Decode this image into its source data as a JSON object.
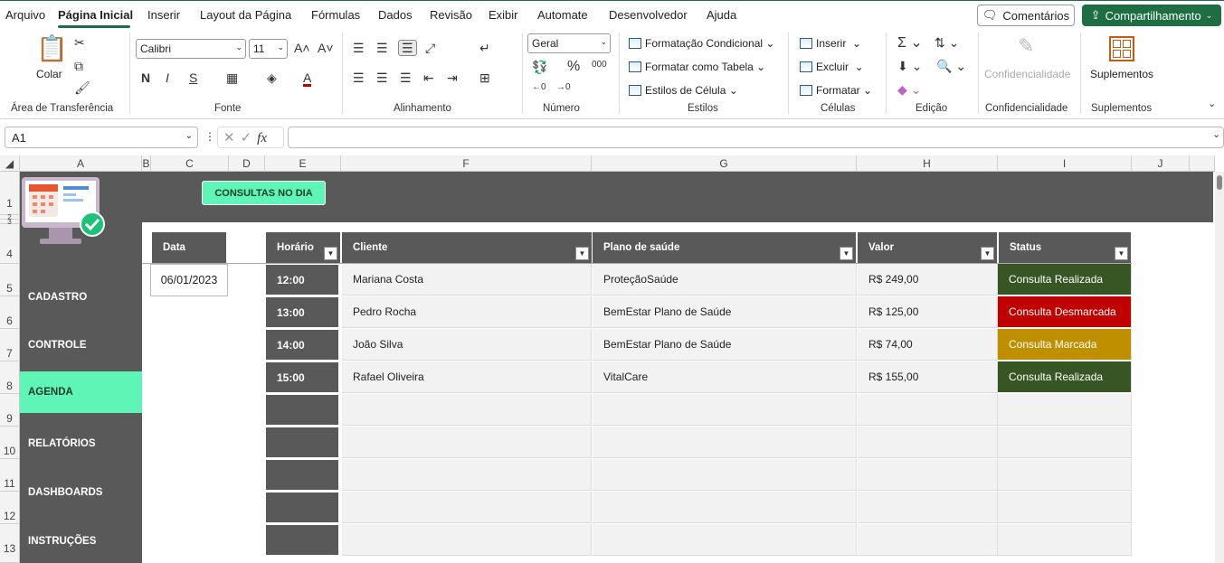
{
  "menu": [
    "Arquivo",
    "Página Inicial",
    "Inserir",
    "Layout da Página",
    "Fórmulas",
    "Dados",
    "Revisão",
    "Exibir",
    "Automate",
    "Desenvolvedor",
    "Ajuda"
  ],
  "menu_active": "Página Inicial",
  "comments_label": "Comentários",
  "share_label": "Compartilhamento",
  "ribbon": {
    "paste_label": "Colar",
    "clipboard_group": "Área de Transferência",
    "font_name": "Calibri",
    "font_size": "11",
    "font_group": "Fonte",
    "align_group": "Alinhamento",
    "number_format": "Geral",
    "number_group": "Número",
    "cond_format": "Formatação Condicional",
    "format_table": "Formatar como Tabela",
    "cell_styles": "Estilos de Célula",
    "styles_group": "Estilos",
    "insert": "Inserir",
    "delete": "Excluir",
    "format": "Formatar",
    "cells_group": "Células",
    "edit_group": "Edição",
    "confidential": "Confidencialidade",
    "confidential_group": "Confidencialidade",
    "addins": "Suplementos",
    "addins_group": "Suplementos"
  },
  "formula_bar": {
    "name_box": "A1",
    "fx": "fx",
    "value": ""
  },
  "columns": [
    "A",
    "B",
    "C",
    "D",
    "E",
    "F",
    "G",
    "H",
    "I",
    "J"
  ],
  "rows": [
    "1",
    "2",
    "3",
    "4",
    "5",
    "6",
    "7",
    "8",
    "9",
    "10",
    "11",
    "12",
    "13"
  ],
  "consult_button": "CONSULTAS NO DIA",
  "nav": [
    "CADASTRO",
    "CONTROLE",
    "AGENDA",
    "RELATÓRIOS",
    "DASHBOARDS",
    "INSTRUÇÕES"
  ],
  "nav_active": "AGENDA",
  "date_header": "Data",
  "date_value": "06/01/2023",
  "table": {
    "headers": {
      "time": "Horário",
      "client": "Cliente",
      "plan": "Plano de saúde",
      "value": "Valor",
      "status": "Status"
    },
    "rows": [
      {
        "time": "12:00",
        "client": "Mariana Costa",
        "plan": "ProteçãoSaúde",
        "value": "R$ 249,00",
        "status": "Consulta Realizada",
        "status_color": "#375623"
      },
      {
        "time": "13:00",
        "client": "Pedro Rocha",
        "plan": "BemEstar Plano de Saúde",
        "value": "R$ 125,00",
        "status": "Consulta Desmarcada",
        "status_color": "#c00000"
      },
      {
        "time": "14:00",
        "client": "João Silva",
        "plan": "BemEstar Plano de Saúde",
        "value": "R$ 74,00",
        "status": "Consulta Marcada",
        "status_color": "#bf8f00"
      },
      {
        "time": "15:00",
        "client": "Rafael Oliveira",
        "plan": "VitalCare",
        "value": "R$ 155,00",
        "status": "Consulta Realizada",
        "status_color": "#375623"
      }
    ],
    "empty_rows": 5
  },
  "colors": {
    "accent": "#1e6e43",
    "dark_band": "#595959",
    "mint": "#5ef5b6"
  }
}
